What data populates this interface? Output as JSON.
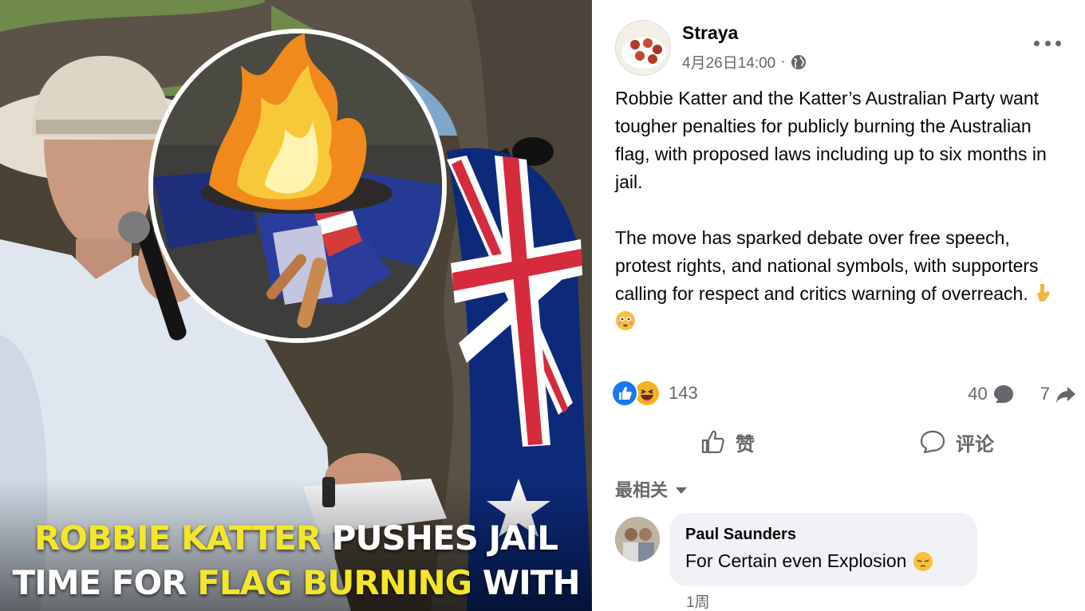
{
  "media": {
    "headline_line1_highlight": "ROBBIE KATTER",
    "headline_line1_rest": " PUSHES JAIL",
    "headline_line2_start": "TIME FOR ",
    "headline_line2_highlight": "FLAG BURNING",
    "headline_line2_rest": " WITH",
    "highlight_color": "#f3e62b"
  },
  "post": {
    "page_name": "Straya",
    "timestamp": "4月26日14:00",
    "separator": "·",
    "privacy_icon": "globe-icon",
    "paragraph1": "Robbie Katter and the Katter’s Australian Party want tougher penalties for publicly burning the Australian flag, with proposed laws including up to six months in jail.",
    "paragraph2": "The move has sparked debate over free speech, protest rights, and national symbols, with supporters calling for respect and critics warning of overreach.",
    "paragraph2_emojis": [
      "pointing-down-emoji",
      "flushed-face-emoji"
    ],
    "reactions": {
      "icons": [
        "like-reaction-icon",
        "haha-reaction-icon"
      ],
      "count": "143"
    },
    "comment_count": "40",
    "share_count": "7",
    "actions": {
      "like_label": "赞",
      "comment_label": "评论"
    },
    "sort_label": "最相关",
    "comments": [
      {
        "author": "Paul Saunders",
        "text": "For Certain even Explosion",
        "emoji": "pensive-face-emoji",
        "time": "1周"
      }
    ],
    "colors": {
      "facebook_blue": "#1877f2",
      "secondary_text": "#65676b",
      "bubble_bg": "#f0f2f5"
    }
  }
}
